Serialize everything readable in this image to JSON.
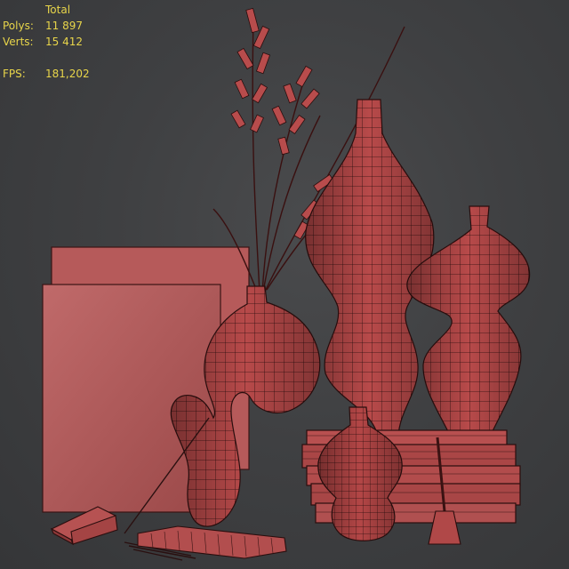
{
  "stats": {
    "header": "Total",
    "polys_label": "Polys:",
    "polys_value": "11 897",
    "verts_label": "Verts:",
    "verts_value": "15 412",
    "fps_label": "FPS:",
    "fps_value": "181,202"
  },
  "colors": {
    "background": "#3f4042",
    "stats_text": "#e8d54a",
    "mesh_fill": "#b84848",
    "wire": "#1a0a0a"
  }
}
